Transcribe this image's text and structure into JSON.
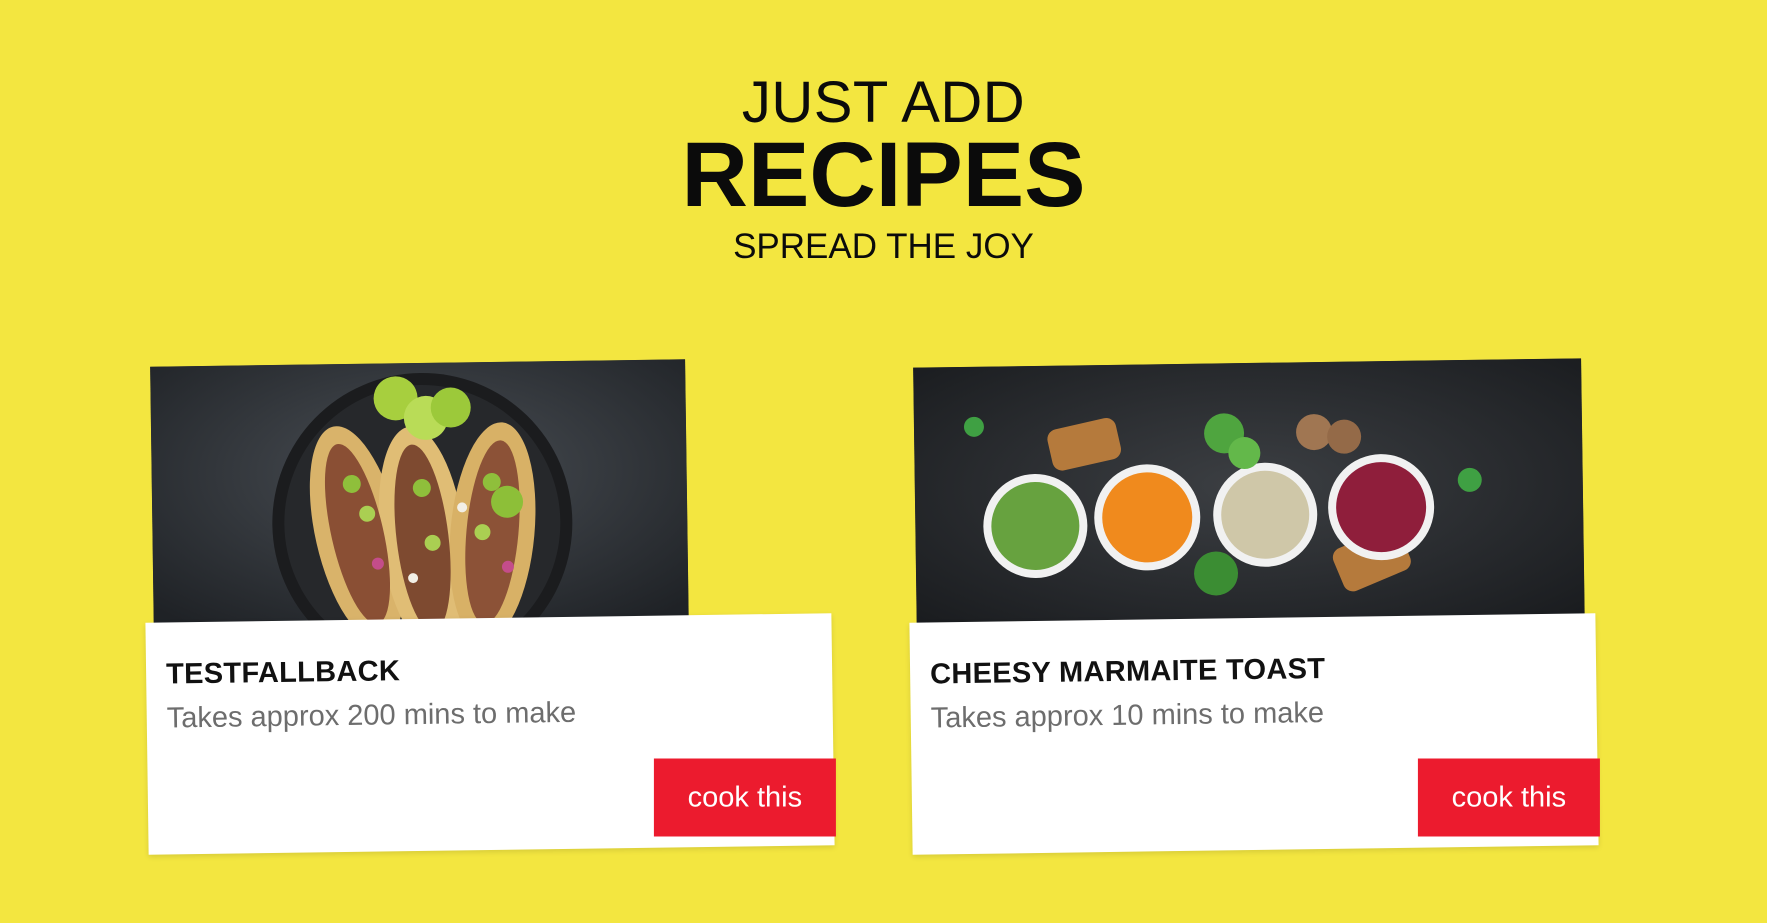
{
  "hero": {
    "kicker": "JUST ADD",
    "title": "RECIPES",
    "tagline": "SPREAD THE JOY"
  },
  "colors": {
    "background": "#f3e640",
    "button": "#ec1b2e",
    "card": "#ffffff",
    "title_text": "#0b0b0b",
    "meta_text": "#6d6d6d"
  },
  "recipes": [
    {
      "name": "TESTFALLBACK",
      "meta": "Takes approx 200 mins to make",
      "button": "cook this",
      "image": "tacos-photo"
    },
    {
      "name": "CHEESY MARMAITE TOAST",
      "meta": "Takes approx 10 mins to make",
      "button": "cook this",
      "image": "soups-photo"
    }
  ]
}
